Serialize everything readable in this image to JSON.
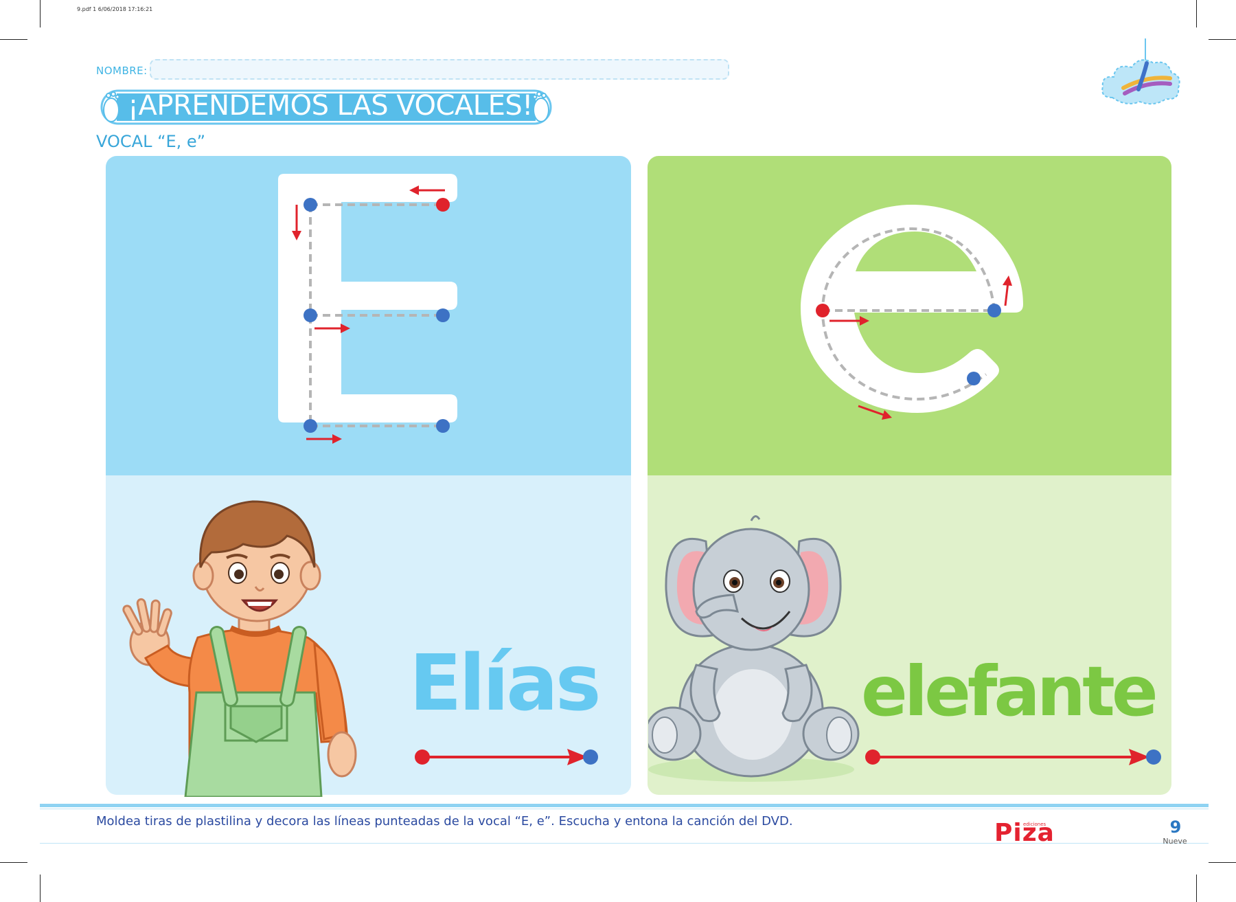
{
  "print_info": "9.pdf   1   6/06/2018   17:16:21",
  "header": {
    "name_label": "NOMBRE:",
    "title": "¡APRENDEMOS LAS VOCALES!",
    "subtitle": "VOCAL “E, e”"
  },
  "cards": {
    "uppercase": {
      "letter": "E",
      "word": "Elías",
      "color_top": "#9cdcf6",
      "color_bottom": "#d8f0fb",
      "word_color": "#66c9f1"
    },
    "lowercase": {
      "letter": "e",
      "word": "elefante",
      "color_top": "#b0de78",
      "color_bottom": "#e0f1cb",
      "word_color": "#7cc843"
    }
  },
  "footer": {
    "instruction": "Moldea tiras de plastilina y decora las líneas punteadas de la vocal “E, e”. Escucha y entona la canción del DVD.",
    "brand": "Piza",
    "brand_sub": "ediciones",
    "page_number": "9",
    "page_word": "Nueve"
  },
  "colors": {
    "accent_blue": "#3fb4e4",
    "dot_blue": "#3d72c4",
    "dot_red": "#e0232c",
    "brand_red": "#e42230"
  }
}
